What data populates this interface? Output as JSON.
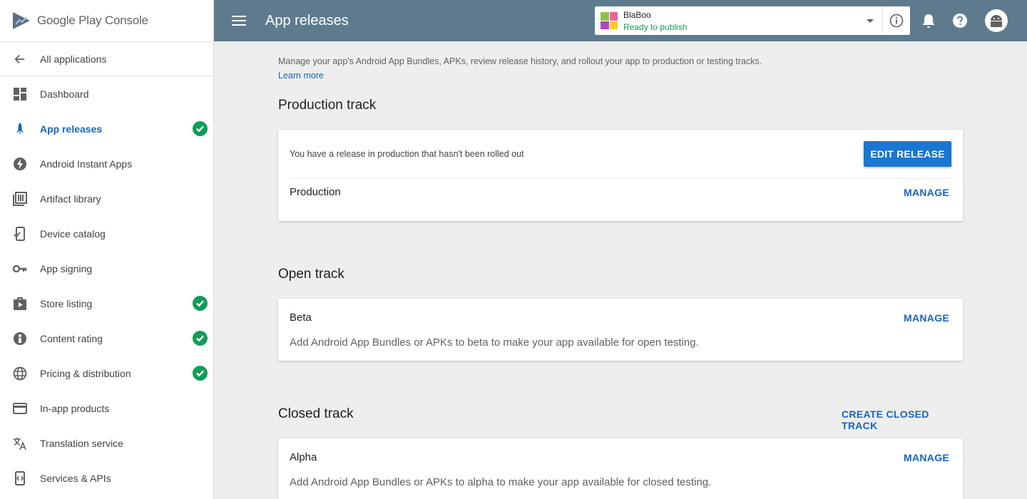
{
  "brand": {
    "name_main": "Google Play",
    "name_suffix": "Console"
  },
  "sidebar": {
    "back_label": "All applications",
    "items": [
      {
        "label": "Dashboard",
        "icon": "dashboard-icon",
        "checked": false,
        "active": false
      },
      {
        "label": "App releases",
        "icon": "rocket-icon",
        "checked": true,
        "active": true
      },
      {
        "label": "Android Instant Apps",
        "icon": "bolt-icon",
        "checked": false,
        "active": false
      },
      {
        "label": "Artifact library",
        "icon": "library-icon",
        "checked": false,
        "active": false
      },
      {
        "label": "Device catalog",
        "icon": "device-icon",
        "checked": false,
        "active": false
      },
      {
        "label": "App signing",
        "icon": "key-icon",
        "checked": false,
        "active": false
      },
      {
        "label": "Store listing",
        "icon": "store-icon",
        "checked": true,
        "active": false
      },
      {
        "label": "Content rating",
        "icon": "rating-icon",
        "checked": true,
        "active": false
      },
      {
        "label": "Pricing & distribution",
        "icon": "globe-icon",
        "checked": true,
        "active": false
      },
      {
        "label": "In-app products",
        "icon": "card-icon",
        "checked": false,
        "active": false
      },
      {
        "label": "Translation service",
        "icon": "translate-icon",
        "checked": false,
        "active": false
      },
      {
        "label": "Services & APIs",
        "icon": "api-icon",
        "checked": false,
        "active": false
      }
    ]
  },
  "header": {
    "title": "App releases",
    "app_name": "BlaBoo",
    "app_status": "Ready to publish"
  },
  "main": {
    "intro": "Manage your app's Android App Bundles, APKs, review release history, and rollout your app to production or testing tracks.",
    "learn_more": "Learn more",
    "production": {
      "title": "Production track",
      "notice": "You have a release in production that hasn't been rolled out",
      "edit_label": "EDIT RELEASE",
      "track_name": "Production",
      "manage_label": "MANAGE"
    },
    "open": {
      "title": "Open track",
      "track_name": "Beta",
      "manage_label": "MANAGE",
      "description": "Add Android App Bundles or APKs to beta to make your app available for open testing."
    },
    "closed": {
      "title": "Closed track",
      "create_label": "CREATE CLOSED TRACK",
      "track_name": "Alpha",
      "manage_label": "MANAGE",
      "description": "Add Android App Bundles or APKs to alpha to make your app available for closed testing."
    }
  },
  "colors": {
    "accent": "#1565c0",
    "topbar": "#5e7b8e",
    "success": "#0f9d58"
  }
}
